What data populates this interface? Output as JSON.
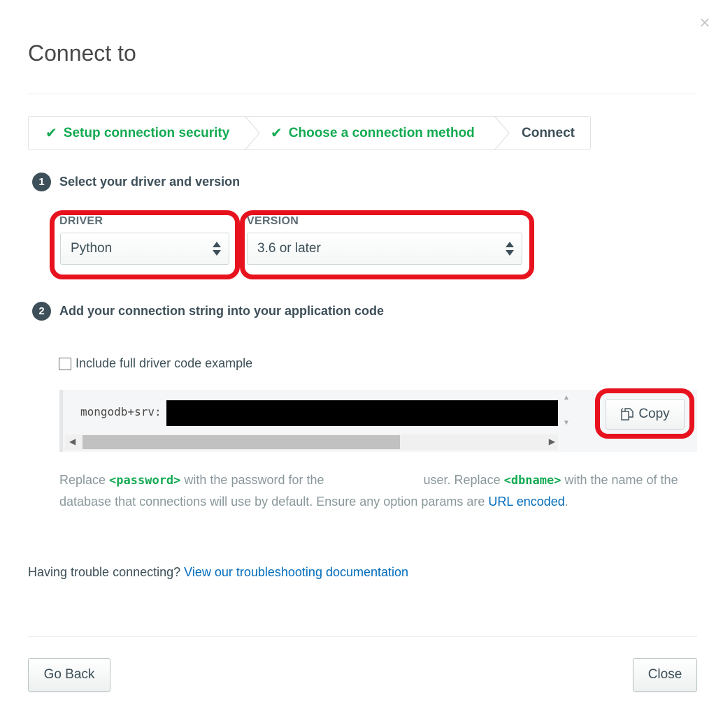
{
  "modal": {
    "title": "Connect to",
    "close_icon": "close-icon"
  },
  "steps": [
    {
      "label": "Setup connection security",
      "status": "complete"
    },
    {
      "label": "Choose a connection method",
      "status": "complete"
    },
    {
      "label": "Connect",
      "status": "current"
    }
  ],
  "section1": {
    "number": "1",
    "heading": "Select your driver and version",
    "driver_label": "DRIVER",
    "driver_value": "Python",
    "version_label": "VERSION",
    "version_value": "3.6 or later"
  },
  "section2": {
    "number": "2",
    "heading": "Add your connection string into your application code",
    "checkbox_label": "Include full driver code example",
    "checkbox_checked": false,
    "connection_string": "mongodb+srv:",
    "copy_label": "Copy"
  },
  "help": {
    "p1": "Replace ",
    "password_token": "<password>",
    "p2": " with the password for the ",
    "p3": " user. Replace ",
    "dbname_token": "<dbname>",
    "p4": " with the name of the database that connections will use by default. Ensure any option params are ",
    "link": "URL encoded",
    "p5": "."
  },
  "trouble": {
    "text": "Having trouble connecting? ",
    "link": "View our troubleshooting documentation"
  },
  "footer": {
    "back_label": "Go Back",
    "close_label": "Close"
  },
  "colors": {
    "success_green": "#13aa52",
    "link_blue": "#006cbc",
    "annotation_red": "#e8121f",
    "text_dark": "#3d4f58"
  }
}
